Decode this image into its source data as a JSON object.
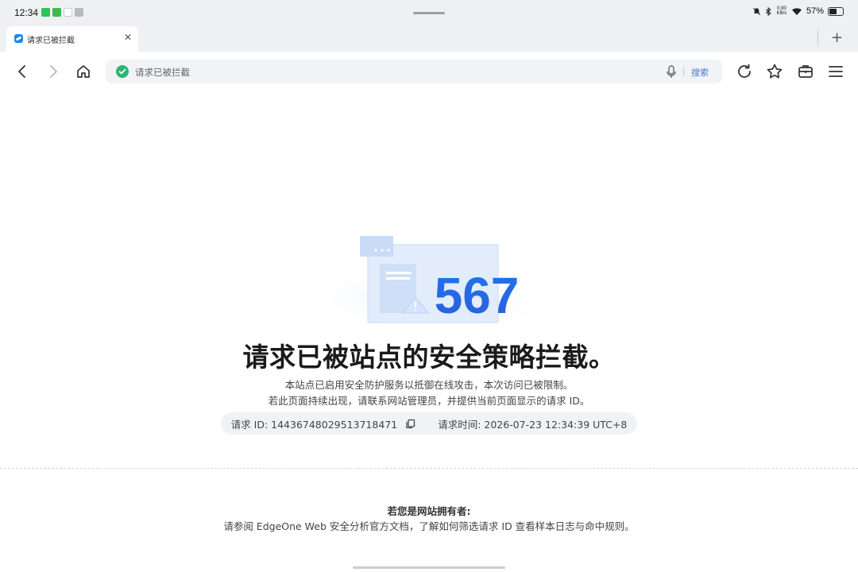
{
  "status_bar": {
    "time": "12:34",
    "net_speed_value": "0.90",
    "net_speed_unit": "KB/s",
    "battery_percent": "57%",
    "battery_level": 0.57
  },
  "tab": {
    "title": "请求已被拦截",
    "close_glyph": "✕"
  },
  "new_tab_glyph": "+",
  "address_bar": {
    "text": "请求已被拦截",
    "search_label": "搜索"
  },
  "illustration": {
    "code": "567"
  },
  "main": {
    "title": "请求已被站点的安全策略拦截。",
    "desc_line1": "本站点已启用安全防护服务以抵御在线攻击，本次访问已被限制。",
    "desc_line2": "若此页面持续出现，请联系网站管理员，并提供当前页面显示的请求 ID。",
    "request_id": "请求 ID: 14436748029513718471",
    "request_time": "请求时间: 2026-07-23 12:34:39 UTC+8"
  },
  "owner": {
    "title": "若您是网站拥有者:",
    "text": "请参阅 EdgeOne Web 安全分析官方文档，了解如何筛选请求 ID 查看样本日志与命中规则。"
  },
  "colors": {
    "accent_blue": "#1e6fe8",
    "shield_green": "#2bb673",
    "search_link": "#4a76d9"
  }
}
